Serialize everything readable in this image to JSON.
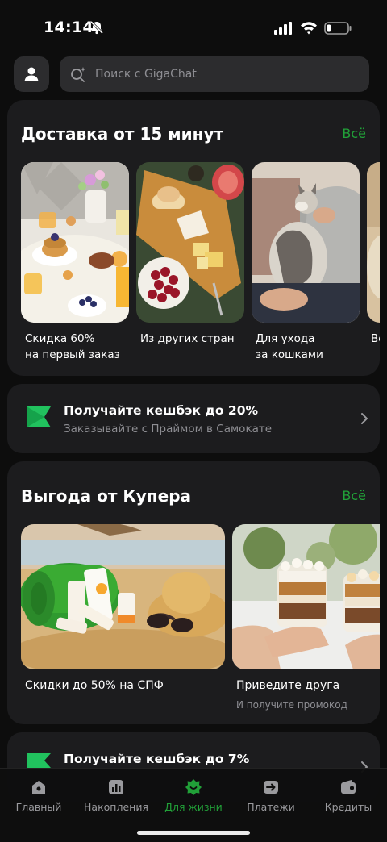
{
  "status_bar": {
    "time": "14:14",
    "battery_level": 0.2
  },
  "search": {
    "placeholder": "Поиск с GigaChat"
  },
  "delivery": {
    "title": "Доставка от 15 минут",
    "all": "Всё",
    "tiles": [
      {
        "line1": "Скидка 60%",
        "line2": "на первый заказ"
      },
      {
        "line1": "Из других стран",
        "line2": ""
      },
      {
        "line1": "Для ухода",
        "line2": "за кошками"
      },
      {
        "line1": "Во",
        "line2": ""
      }
    ]
  },
  "promo1": {
    "title": "Получайте кешбэк до 20%",
    "subtitle": "Заказывайте с Праймом в Самокате"
  },
  "kuper": {
    "title": "Выгода от Купера",
    "all": "Всё",
    "tiles": [
      {
        "title": "Скидки до 50% на СПФ",
        "subtitle": ""
      },
      {
        "title": "Приведите друга",
        "subtitle": "И получите промокод"
      }
    ]
  },
  "promo2": {
    "title": "Получайте кешбэк до 7%"
  },
  "tabs": [
    {
      "label": "Главный",
      "icon": "home-icon"
    },
    {
      "label": "Накопления",
      "icon": "chart-icon"
    },
    {
      "label": "Для жизни",
      "icon": "lifestyle-icon",
      "active": true
    },
    {
      "label": "Платежи",
      "icon": "transfer-icon"
    },
    {
      "label": "Кредиты",
      "icon": "wallet-icon"
    }
  ],
  "colors": {
    "accent": "#21a038",
    "background": "#0d0d0d",
    "card": "#1c1c1e"
  }
}
